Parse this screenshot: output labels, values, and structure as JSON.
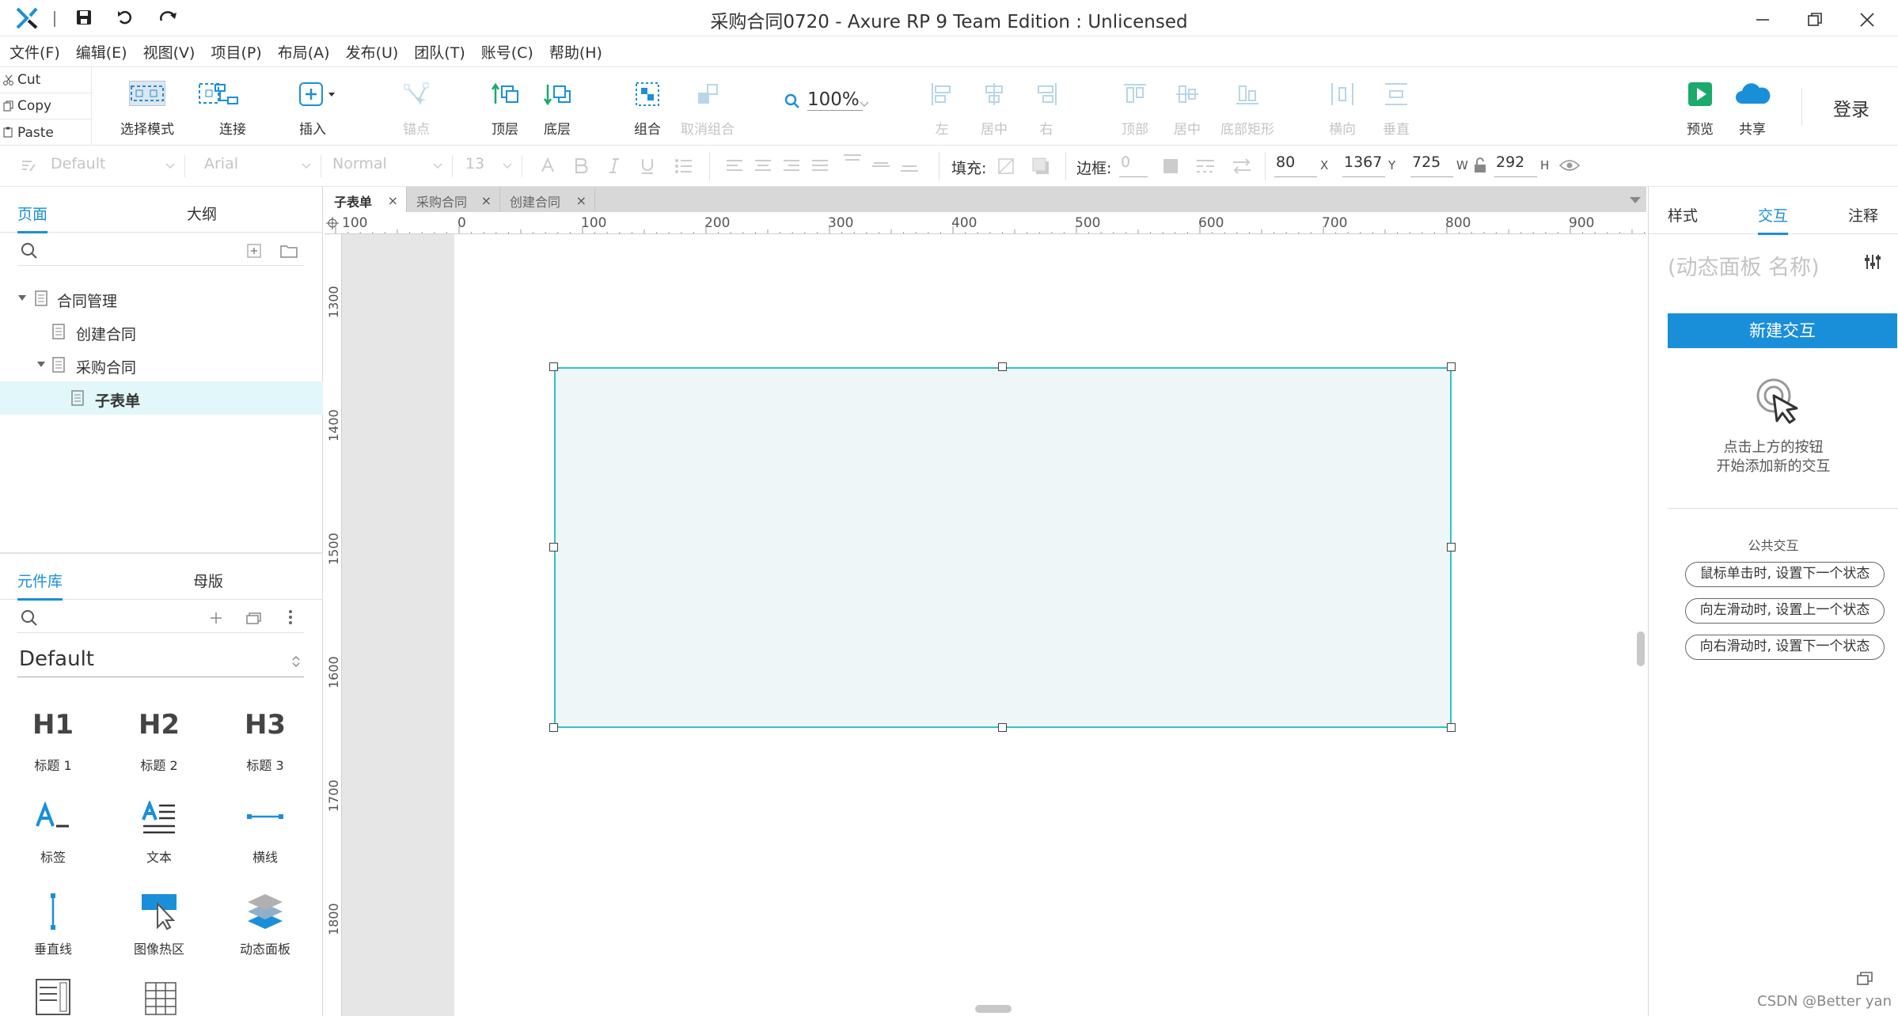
{
  "window": {
    "title": "采购合同0720 - Axure RP 9 Team Edition : Unlicensed"
  },
  "menu": [
    "文件(F)",
    "编辑(E)",
    "视图(V)",
    "项目(P)",
    "布局(A)",
    "发布(U)",
    "团队(T)",
    "账号(C)",
    "帮助(H)"
  ],
  "clipboard": {
    "cut": "Cut",
    "copy": "Copy",
    "paste": "Paste"
  },
  "toolbar": {
    "select_mode": "选择模式",
    "connect": "连接",
    "insert": "插入",
    "points": "锚点",
    "top_layer": "顶层",
    "bottom_layer": "底层",
    "group": "组合",
    "ungroup": "取消组合",
    "zoom": "100%",
    "align_left": "左",
    "align_center": "居中",
    "align_right": "右",
    "align_top": "顶部",
    "align_middle": "居中",
    "align_bottom": "底部矩形",
    "distribute_h": "横向",
    "distribute_v": "垂直",
    "preview": "预览",
    "share": "共享",
    "login": "登录"
  },
  "format": {
    "style": "Default",
    "font": "Arial",
    "weight": "Normal",
    "size": "13",
    "fill_label": "填充:",
    "border_label": "边框:",
    "border_value": "0",
    "x": "80",
    "x_unit": "X",
    "y": "1367",
    "y_unit": "Y",
    "w": "725",
    "w_unit": "W",
    "h": "292",
    "h_unit": "H"
  },
  "pages": {
    "tabs": [
      "页面",
      "大纲"
    ],
    "items": [
      {
        "label": "合同管理"
      },
      {
        "label": "创建合同"
      },
      {
        "label": "采购合同"
      },
      {
        "label": "子表单"
      }
    ]
  },
  "library": {
    "tabs": [
      "元件库",
      "母版"
    ],
    "selected": "Default",
    "widgets": [
      {
        "label": "标题 1",
        "glyph": "H1"
      },
      {
        "label": "标题 2",
        "glyph": "H2"
      },
      {
        "label": "标题 3",
        "glyph": "H3"
      },
      {
        "label": "标签"
      },
      {
        "label": "文本"
      },
      {
        "label": "横线"
      },
      {
        "label": "垂直线"
      },
      {
        "label": "图像热区"
      },
      {
        "label": "动态面板"
      }
    ]
  },
  "doc_tabs": [
    {
      "label": "子表单"
    },
    {
      "label": "采购合同"
    },
    {
      "label": "创建合同"
    }
  ],
  "ruler": {
    "h": [
      "100",
      "0",
      "100",
      "200",
      "300",
      "400",
      "500",
      "600",
      "700",
      "800",
      "900"
    ],
    "v": [
      "1300",
      "1400",
      "1500",
      "1600",
      "1700",
      "1800"
    ]
  },
  "right_panel": {
    "tabs": [
      "样式",
      "交互",
      "注释"
    ],
    "panel_name_placeholder": "(动态面板 名称)",
    "new_interaction": "新建交互",
    "hint_line1": "点击上方的按钮",
    "hint_line2": "开始添加新的交互",
    "public_header": "公共交互",
    "public_items": [
      "鼠标单击时, 设置下一个状态",
      "向左滑动时, 设置上一个状态",
      "向右滑动时, 设置下一个状态"
    ]
  },
  "watermark": "CSDN @Better yan",
  "colors": {
    "accent": "#1a8fd9",
    "selection": "#2ec4c4",
    "panel_fill": "#eef6f8"
  }
}
